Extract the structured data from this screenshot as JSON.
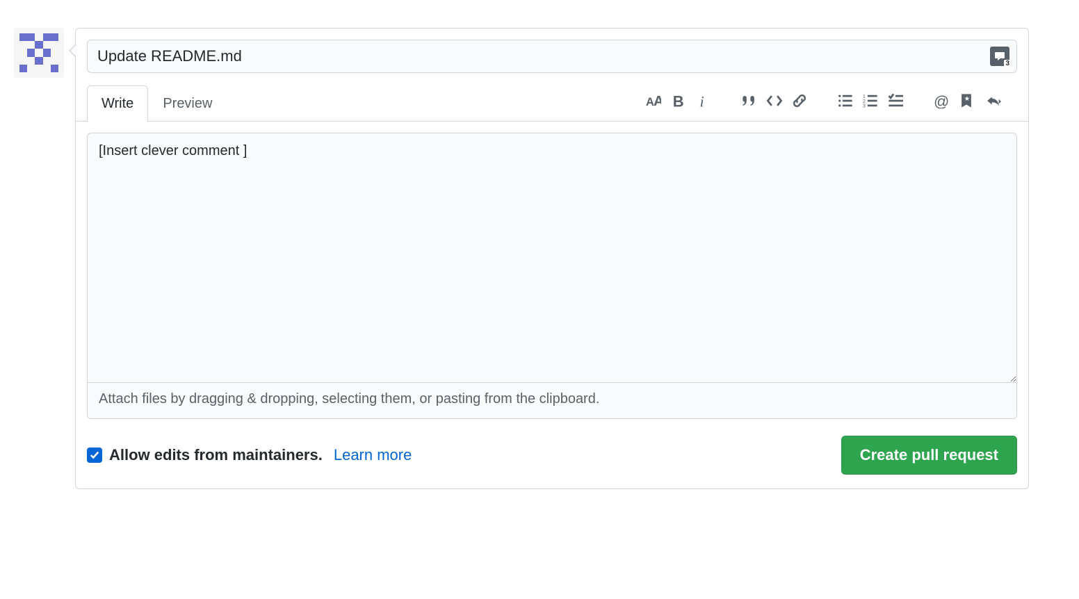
{
  "title": {
    "value": "Update README.md"
  },
  "tabs": {
    "write": "Write",
    "preview": "Preview"
  },
  "comment": {
    "value": "[Insert clever comment ]",
    "attach_hint": "Attach files by dragging & dropping, selecting them, or pasting from the clipboard."
  },
  "footer": {
    "allow_edits_label": "Allow edits from maintainers.",
    "learn_more": "Learn more",
    "create_button": "Create pull request"
  },
  "saved_reply_badge": "3"
}
